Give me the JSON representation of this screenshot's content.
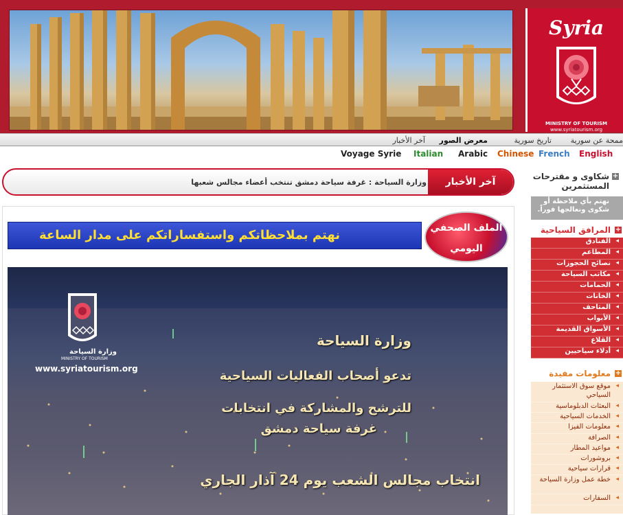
{
  "header": {
    "logo_text": "Syria",
    "logo_subtitle": "MINISTRY OF TOURISM",
    "logo_url": "www.syriatourism.org"
  },
  "nav": {
    "items": [
      "ممحة عن سورية",
      "تاريخ سورية",
      "معرض الصور",
      "آخر الأخبار"
    ],
    "bold_index": 2
  },
  "languages": [
    {
      "label": "English",
      "color": "#c8102e"
    },
    {
      "label": "French",
      "color": "#3a7cc2"
    },
    {
      "label": "Chinese",
      "color": "#d35400"
    },
    {
      "label": "Arabic",
      "color": "#222222"
    },
    {
      "label": "Italian",
      "color": "#2e8b2e"
    },
    {
      "label": "Voyage Syrie",
      "color": "#222222"
    }
  ],
  "ticker": {
    "label": "آخر الأخبار",
    "text": "وزارة السياحة : غرفة سياحة دمشق تنتخب أعضاء مجالس شعبها"
  },
  "content": {
    "banner_text": "نهتم بملاحظاتكم واستفساراتكم على مدار الساعة",
    "press_line1": "الملف الصحفي",
    "press_line2": "اليومي",
    "poster": {
      "ministry_ar": "وزارة السياحة",
      "ministry_en": "MINISTRY OF TOURISM",
      "url": "www.syriatourism.org",
      "line1": "وزارة السياحة",
      "line2": "تدعو أصحاب الفعاليات السياحية",
      "line3": "للترشح والمشاركة في انتخابات",
      "line4": "غرفة سياحة دمشق",
      "line5": "انتخاب مجالس الشعب يوم 24 آذار الجاري"
    }
  },
  "sidebar": {
    "complaints": {
      "title": "شكاوى و مقترحات المستثمرين",
      "text": "نهتم بأي ملاحظة أو شكوى ونعالجها فوراً."
    },
    "facilities": {
      "title": "المرافق السياحية",
      "items": [
        "الفنادق",
        "المطاعم",
        "نصائح الحجوزات",
        "مكاتب السياحة",
        "الحمامات",
        "الخانات",
        "المتاحف",
        "الأبواب",
        "الأسواق القديمة",
        "القلاع",
        "أدلاء سياحيين"
      ]
    },
    "info": {
      "title": "معلومات مفيدة",
      "items": [
        "موقع سوق الاستثمار السياحي",
        "البعثات الدبلوماسية",
        "الخدمات السياحية",
        "معلومات الفيزا",
        "الصرافة",
        "مواعيد المطار",
        "بروشورات",
        "قرارات سياحية",
        "خطة عمل وزارة السياحة",
        "السفارات"
      ]
    }
  }
}
